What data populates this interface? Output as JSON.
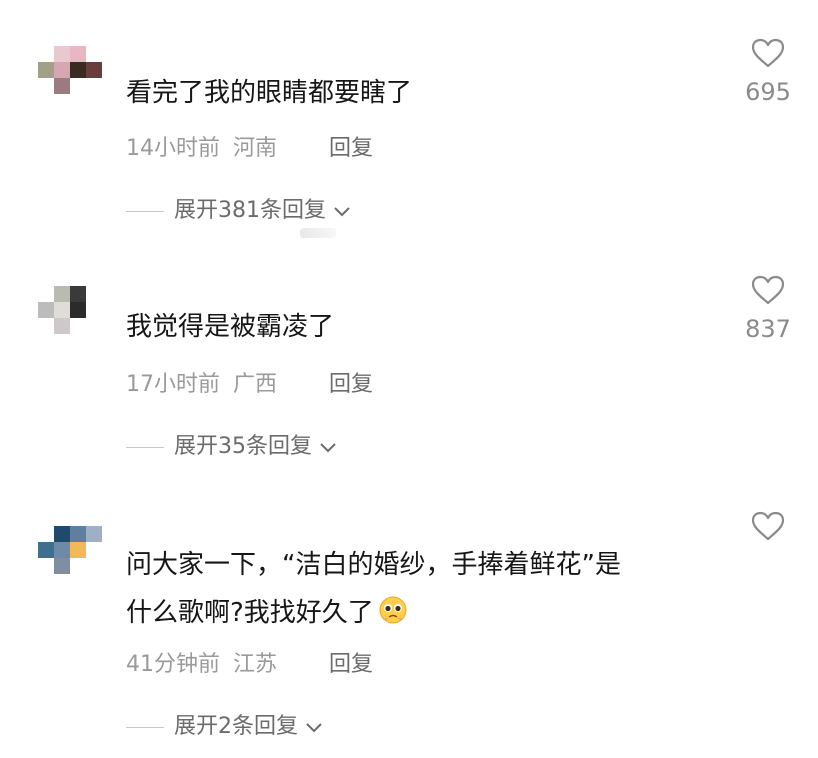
{
  "comments": [
    {
      "username": "",
      "text": "看完了我的眼睛都要瞎了",
      "time": "14小时前",
      "location": "河南",
      "reply_label": "回复",
      "expand_label": "展开381条回复",
      "likes": "695",
      "avatar_colors": [
        "#ffffff",
        "#e8c9cf",
        "#e9b7c3",
        "#ffffff",
        "#a3a08a",
        "#d6a6b3",
        "#3b2a22",
        "#6a3d3d",
        "#ffffff",
        "#9c7b80",
        "#ffffff",
        "#ffffff"
      ]
    },
    {
      "username": "",
      "text": "我觉得是被霸凌了",
      "time": "17小时前",
      "location": "广西",
      "reply_label": "回复",
      "expand_label": "展开35条回复",
      "likes": "837",
      "avatar_colors": [
        "#ffffff",
        "#b9bbb3",
        "#3a3a3a",
        "#ffffff",
        "#bcbcbc",
        "#e0dcd6",
        "#2b2b2b",
        "#ffffff",
        "#ffffff",
        "#cfc7c9",
        "#ffffff",
        "#ffffff"
      ]
    },
    {
      "username": "",
      "text_line1": "问大家一下，“洁白的婚纱，手捧着鲜花”是",
      "text_line2": "什么歌啊?我找好久了",
      "time": "41分钟前",
      "location": "江苏",
      "reply_label": "回复",
      "expand_label": "展开2条回复",
      "avatar_colors": [
        "#ffffff",
        "#1f4a6b",
        "#5f7fa0",
        "#9fb0c4",
        "#3d6f8e",
        "#6d8aa8",
        "#f2b85a",
        "#ffffff",
        "#ffffff",
        "#7f8ea0",
        "#ffffff",
        "#ffffff"
      ],
      "emoji": "pleading-face-emoji"
    }
  ],
  "colors": {
    "text": "#161616",
    "meta": "#9a9a9a",
    "action": "#6b6b6b",
    "heart": "#8a8a8a"
  }
}
